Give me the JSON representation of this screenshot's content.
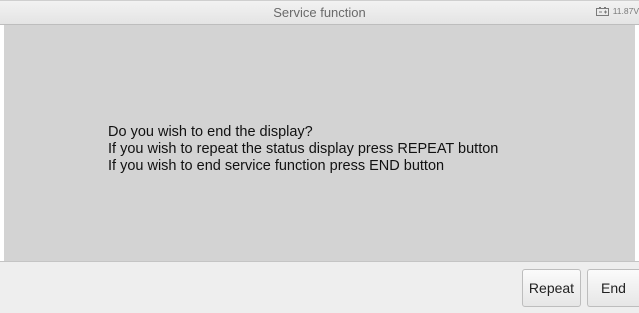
{
  "header": {
    "title": "Service function",
    "battery_icon": "battery-icon",
    "voltage": "11.87V"
  },
  "message": {
    "lines": [
      "Do you wish to end the display?",
      "If you wish to repeat the status display press REPEAT button",
      "If you wish to end service function press END button"
    ]
  },
  "footer": {
    "repeat_label": "Repeat",
    "end_label": "End"
  },
  "colors": {
    "content_background": "#d3d3d3",
    "header_background": "#e8e8e8",
    "footer_background": "#eeeeee"
  }
}
